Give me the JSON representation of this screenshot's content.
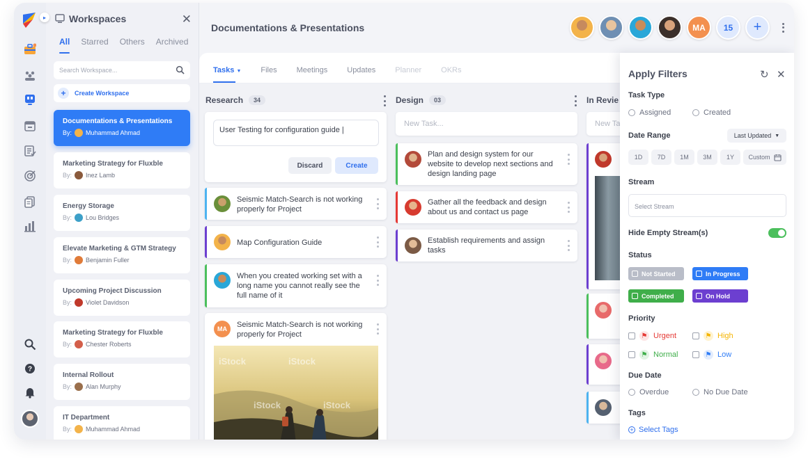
{
  "app": {
    "accent": "#2f6fed"
  },
  "workspaces": {
    "title": "Workspaces",
    "tabs": [
      "All",
      "Starred",
      "Others",
      "Archived"
    ],
    "search_placeholder": "Search Workspace...",
    "create_label": "Create Workspace",
    "by_label": "By:",
    "items": [
      {
        "title": "Documentations & Presentations",
        "by": "Muhammad Ahmad",
        "selected": true
      },
      {
        "title": "Marketing Strategy for Fluxble",
        "by": "Inez Lamb"
      },
      {
        "title": "Energy Storage",
        "by": "Lou Bridges"
      },
      {
        "title": "Elevate Marketing & GTM Strategy",
        "by": "Benjamin Fuller"
      },
      {
        "title": "Upcoming Project Discussion",
        "by": "Violet Davidson"
      },
      {
        "title": "Marketing Strategy for Fluxble",
        "by": "Chester Roberts"
      },
      {
        "title": "Internal Rollout",
        "by": "Alan Murphy"
      },
      {
        "title": "IT Department",
        "by": "Muhammad Ahmad"
      }
    ]
  },
  "header": {
    "title": "Documentations & Presentations",
    "initials": "MA",
    "member_count": "15"
  },
  "tabs": [
    "Tasks",
    "Files",
    "Meetings",
    "Updates",
    "Planner",
    "OKRs"
  ],
  "board": {
    "research": {
      "name": "Research",
      "count": "34",
      "draft_value": "User Testing for configuration guide |",
      "discard": "Discard",
      "create": "Create",
      "cards": [
        {
          "text": "Seismic Match-Search is not working properly for Project",
          "color": "#4db3f0"
        },
        {
          "text": "Map Configuration Guide",
          "color": "#6c3fd0"
        },
        {
          "text": "When you created working set with a long name you cannot really see the full name of it",
          "color": "#4bbf5c"
        },
        {
          "text": "Seismic Match-Search is not working properly for Project",
          "initials": "MA"
        }
      ]
    },
    "design": {
      "name": "Design",
      "count": "03",
      "new_task": "New Task...",
      "cards": [
        {
          "text": "Plan and design system for our website to develop next sections and design landing page",
          "color": "#4bbf5c"
        },
        {
          "text": "Gather all the feedback and design about us and contact us page",
          "color": "#e53935"
        },
        {
          "text": "Establish requirements and assign tasks",
          "color": "#6c3fd0"
        }
      ]
    },
    "review": {
      "name": "In Revie",
      "new_task": "New Ta"
    },
    "watermark": "iStock"
  },
  "filters": {
    "title": "Apply Filters",
    "task_type": {
      "label": "Task Type",
      "options": [
        "Assigned",
        "Created"
      ]
    },
    "date_range": {
      "label": "Date Range",
      "sort": "Last Updated",
      "pills": [
        "1D",
        "7D",
        "1M",
        "3M",
        "1Y",
        "Custom"
      ]
    },
    "stream": {
      "label": "Stream",
      "placeholder": "Select Stream"
    },
    "hide_empty": "Hide Empty Stream(s)",
    "status": {
      "label": "Status",
      "items": [
        {
          "name": "Not Started",
          "color": "#b9bdc8"
        },
        {
          "name": "In Progress",
          "color": "#2f7cf6"
        },
        {
          "name": "Completed",
          "color": "#3fae4a"
        },
        {
          "name": "On Hold",
          "color": "#6c3fd0"
        }
      ]
    },
    "priority": {
      "label": "Priority",
      "items": [
        {
          "name": "Urgent",
          "color": "#e53935"
        },
        {
          "name": "High",
          "color": "#f5b400"
        },
        {
          "name": "Normal",
          "color": "#3fae4a"
        },
        {
          "name": "Low",
          "color": "#2f7cf6"
        }
      ]
    },
    "due_date": {
      "label": "Due Date",
      "options": [
        "Overdue",
        "No Due Date"
      ]
    },
    "tags": {
      "label": "Tags",
      "select": "Select Tags"
    }
  }
}
